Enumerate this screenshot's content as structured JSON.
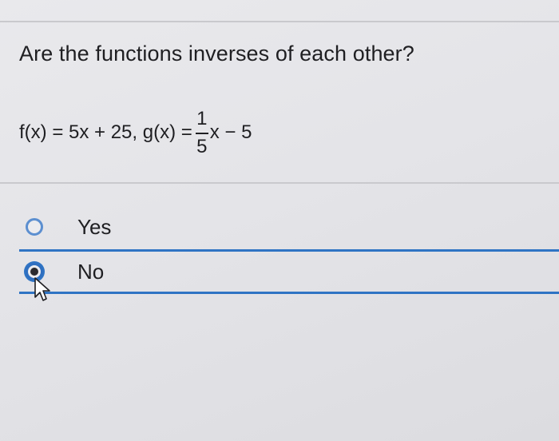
{
  "question": {
    "text": "Are the functions inverses of each other?"
  },
  "equation": {
    "f_part": "f(x) = 5x + 25, g(x) =",
    "fraction_numerator": "1",
    "fraction_denominator": "5",
    "g_tail": "x − 5"
  },
  "options": [
    {
      "label": "Yes",
      "selected": false
    },
    {
      "label": "No",
      "selected": true
    }
  ],
  "colors": {
    "accent": "#2f74c4",
    "text": "#1f1f22",
    "background": "#e6e6e9"
  }
}
